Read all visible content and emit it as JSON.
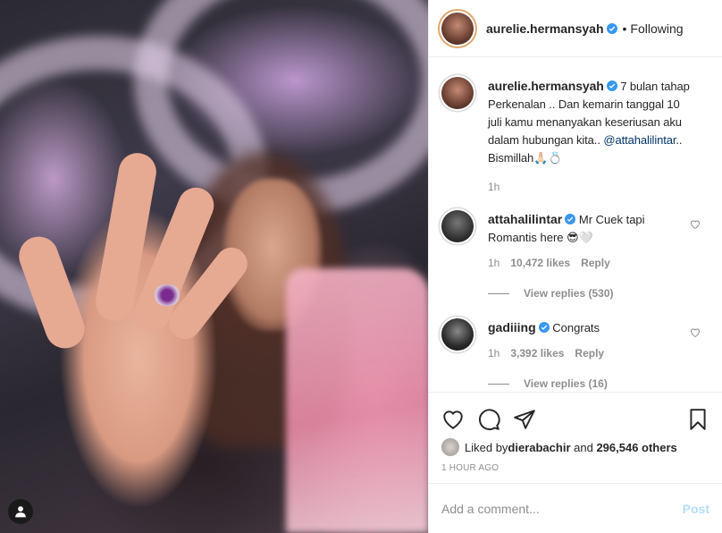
{
  "header": {
    "username": "aurelie.hermansyah",
    "separator": "•",
    "follow_label": "Following"
  },
  "caption": {
    "username": "aurelie.hermansyah",
    "text_before": " 7 bulan tahap Perkenalan .. Dan kemarin tanggal 10 juli kamu menanyakan keseriusan aku dalam hubungan kita.. ",
    "mention": "@attahalilintar",
    "text_after": ".. Bismillah🙏🏻💍",
    "time": "1h"
  },
  "comments": [
    {
      "username": "attahalilintar",
      "text": " Mr Cuek tapi Romantis here 😎🤍",
      "time": "1h",
      "likes": "10,472 likes",
      "reply_label": "Reply",
      "view_replies": "View replies (530)"
    },
    {
      "username": "gadiiing",
      "text": " Congrats",
      "time": "1h",
      "likes": "3,392 likes",
      "reply_label": "Reply",
      "view_replies": "View replies (16)"
    }
  ],
  "likes": {
    "prefix": "Liked by ",
    "user": "dierabachir",
    "middle": " and ",
    "count": "296,546 others"
  },
  "timestamp": "1 HOUR AGO",
  "add_comment": {
    "placeholder": "Add a comment...",
    "post_label": "Post"
  },
  "icons": {
    "verified": "verified-badge-icon",
    "heart": "heart-icon",
    "comment": "comment-icon",
    "share": "share-icon",
    "save": "bookmark-icon",
    "user_tag": "user-icon"
  },
  "colors": {
    "verified": "#3897f0",
    "mention": "#003569",
    "muted": "#8e8e8e",
    "post_disabled": "#b2dffc"
  }
}
